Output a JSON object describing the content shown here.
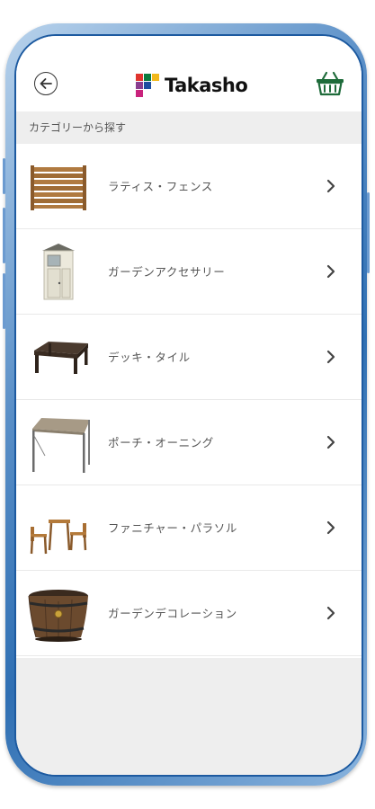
{
  "header": {
    "back_icon": "arrow-left-circle-icon",
    "logo_text": "Takasho",
    "cart_icon": "basket-icon"
  },
  "section": {
    "title": "カテゴリーから探す"
  },
  "categories": [
    {
      "label": "ラティス・フェンス",
      "icon": "lattice-fence-image"
    },
    {
      "label": "ガーデンアクセサリー",
      "icon": "garden-shed-image"
    },
    {
      "label": "デッキ・タイル",
      "icon": "deck-table-image"
    },
    {
      "label": "ポーチ・オーニング",
      "icon": "awning-image"
    },
    {
      "label": "ファニチャー・パラソル",
      "icon": "bistro-set-image"
    },
    {
      "label": "ガーデンデコレーション",
      "icon": "barrel-planter-image"
    }
  ],
  "colors": {
    "accent_green": "#1e6b3a",
    "section_bg": "#eeeeee",
    "frame_blue": "#2f6fb3"
  }
}
